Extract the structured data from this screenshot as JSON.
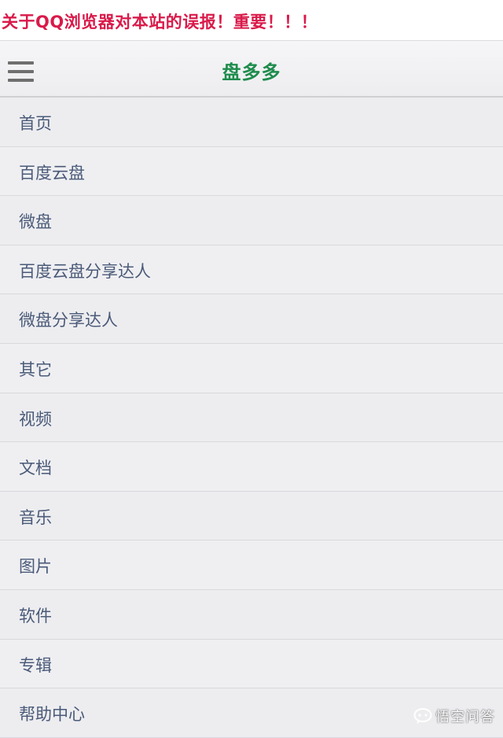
{
  "notice": {
    "text": "关于QQ浏览器对本站的误报！重要！！！",
    "color": "#d91a4a"
  },
  "header": {
    "menu_icon": "hamburger-menu-icon",
    "title": "盘多多",
    "title_color": "#1e8c4c"
  },
  "nav": {
    "items": [
      {
        "label": "首页"
      },
      {
        "label": "百度云盘"
      },
      {
        "label": "微盘"
      },
      {
        "label": "百度云盘分享达人"
      },
      {
        "label": "微盘分享达人"
      },
      {
        "label": "其它"
      },
      {
        "label": "视频"
      },
      {
        "label": "文档"
      },
      {
        "label": "音乐"
      },
      {
        "label": "图片"
      },
      {
        "label": "软件"
      },
      {
        "label": "专辑"
      },
      {
        "label": "帮助中心"
      }
    ]
  },
  "watermark": {
    "icon": "speech-bubble-logo-icon",
    "text": "悟空问答"
  }
}
